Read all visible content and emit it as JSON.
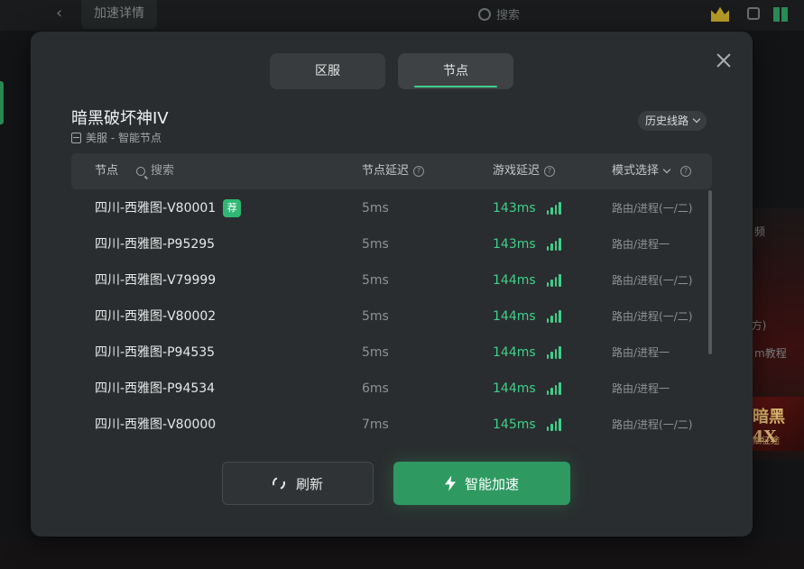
{
  "background": {
    "tab_label": "加速详情",
    "search_placeholder": "搜索",
    "side_text_1": "频",
    "side_text_2": "(方)",
    "side_text_3": "m教程",
    "banner_title": "暗黑4X",
    "banner_sub": "赋征途"
  },
  "modal": {
    "tabs": [
      {
        "label": "区服",
        "selected": false
      },
      {
        "label": "节点",
        "selected": true
      }
    ],
    "game_title": "暗黑破坏神IV",
    "game_sub": "美服 - 智能节点",
    "history_label": "历史线路",
    "table": {
      "headers": {
        "node": "节点",
        "search": "搜索",
        "node_latency": "节点延迟",
        "game_latency": "游戏延迟",
        "mode": "模式选择"
      },
      "recommend_badge": "荐",
      "rows": [
        {
          "name": "四川-西雅图-V80001",
          "node_latency": "5ms",
          "game_latency": "143ms",
          "mode": "路由/进程(一/二)",
          "recommended": true
        },
        {
          "name": "四川-西雅图-P95295",
          "node_latency": "5ms",
          "game_latency": "143ms",
          "mode": "路由/进程一",
          "recommended": false
        },
        {
          "name": "四川-西雅图-V79999",
          "node_latency": "5ms",
          "game_latency": "144ms",
          "mode": "路由/进程(一/二)",
          "recommended": false
        },
        {
          "name": "四川-西雅图-V80002",
          "node_latency": "5ms",
          "game_latency": "144ms",
          "mode": "路由/进程(一/二)",
          "recommended": false
        },
        {
          "name": "四川-西雅图-P94535",
          "node_latency": "5ms",
          "game_latency": "144ms",
          "mode": "路由/进程一",
          "recommended": false
        },
        {
          "name": "四川-西雅图-P94534",
          "node_latency": "6ms",
          "game_latency": "144ms",
          "mode": "路由/进程一",
          "recommended": false
        },
        {
          "name": "四川-西雅图-V80000",
          "node_latency": "7ms",
          "game_latency": "145ms",
          "mode": "路由/进程(一/二)",
          "recommended": false
        }
      ]
    },
    "buttons": {
      "refresh": "刷新",
      "accelerate": "智能加速"
    },
    "colors": {
      "accent": "#3fd08a",
      "accelerate_button": "#2e9a62"
    }
  }
}
